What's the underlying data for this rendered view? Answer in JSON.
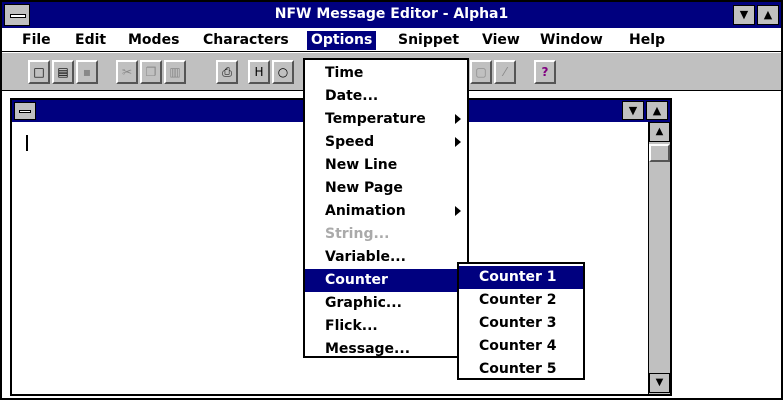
{
  "window": {
    "title": "NFW Message Editor - Alpha1",
    "minimize_label": "▼",
    "maximize_label": "▲"
  },
  "menubar": {
    "items": [
      {
        "label": "File"
      },
      {
        "label": "Edit"
      },
      {
        "label": "Modes"
      },
      {
        "label": "Characters"
      },
      {
        "label": "Options"
      },
      {
        "label": "Snippet"
      },
      {
        "label": "View"
      },
      {
        "label": "Window"
      },
      {
        "label": "Help"
      }
    ]
  },
  "toolbar": {
    "buttons": [
      {
        "icon": "new-file-icon",
        "glyph": "□"
      },
      {
        "icon": "open-file-icon",
        "glyph": "▤"
      },
      {
        "icon": "save-icon",
        "glyph": "▪"
      },
      {
        "icon": "cut-icon",
        "glyph": "✂"
      },
      {
        "icon": "copy-icon",
        "glyph": "❐"
      },
      {
        "icon": "paste-icon",
        "glyph": "▥"
      },
      {
        "icon": "print-icon",
        "glyph": "⎙"
      },
      {
        "icon": "h-icon",
        "glyph": "H"
      },
      {
        "icon": "circle-icon",
        "glyph": "○"
      },
      {
        "icon": "tool-icon",
        "glyph": "▢"
      },
      {
        "icon": "tool2-icon",
        "glyph": "⁄"
      },
      {
        "icon": "help-icon",
        "glyph": "?"
      }
    ]
  },
  "document": {
    "minimize_label": "▼",
    "maximize_label": "▲",
    "scroll_up": "▲",
    "scroll_down": "▼"
  },
  "options_menu": {
    "items": [
      {
        "label": "Time",
        "state": "normal"
      },
      {
        "label": "Date...",
        "state": "normal"
      },
      {
        "label": "Temperature",
        "state": "submenu"
      },
      {
        "label": "Speed",
        "state": "submenu"
      },
      {
        "label": "New Line",
        "state": "normal"
      },
      {
        "label": "New Page",
        "state": "normal"
      },
      {
        "label": "Animation",
        "state": "submenu"
      },
      {
        "label": "String...",
        "state": "disabled"
      },
      {
        "label": "Variable...",
        "state": "normal"
      },
      {
        "label": "Counter",
        "state": "active"
      },
      {
        "label": "Graphic...",
        "state": "normal"
      },
      {
        "label": "Flick...",
        "state": "normal"
      },
      {
        "label": "Message...",
        "state": "normal"
      }
    ]
  },
  "counter_submenu": {
    "items": [
      {
        "label": "Counter 1"
      },
      {
        "label": "Counter 2"
      },
      {
        "label": "Counter 3"
      },
      {
        "label": "Counter 4"
      },
      {
        "label": "Counter 5"
      }
    ]
  },
  "colors": {
    "titlebar": "#00007f",
    "chrome": "#c0c0c0",
    "highlight": "#00007f"
  }
}
